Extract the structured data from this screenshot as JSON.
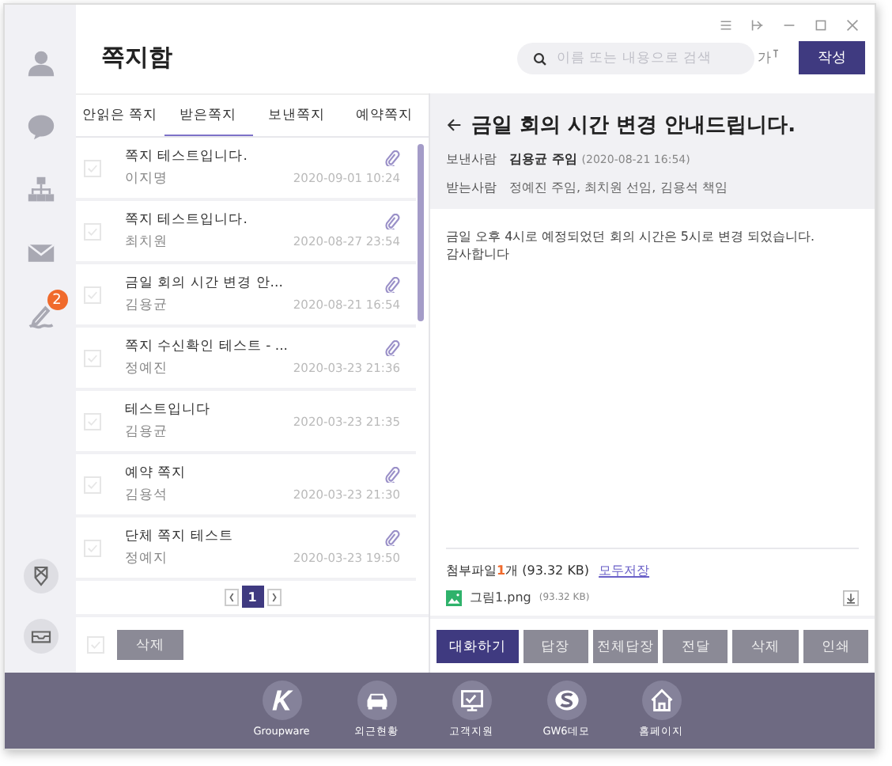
{
  "rail": {
    "badge": "2"
  },
  "header": {
    "title": "쪽지함",
    "search_placeholder": "이름 또는 내용으로 검색",
    "font_size_label": "가",
    "compose": "작성"
  },
  "tabs": [
    {
      "label": "안읽은 쪽지",
      "selected": false
    },
    {
      "label": "받은쪽지",
      "selected": true
    },
    {
      "label": "보낸쪽지",
      "selected": false
    },
    {
      "label": "예약쪽지",
      "selected": false
    }
  ],
  "messages": [
    {
      "subject": "쪽지 테스트입니다.",
      "sender": "이지명",
      "time": "2020-09-01 10:24",
      "attachment": true,
      "checked": false
    },
    {
      "subject": "쪽지 테스트입니다.",
      "sender": "최치원",
      "time": "2020-08-27 23:54",
      "attachment": true,
      "checked": false
    },
    {
      "subject": "금일 회의 시간 변경 안...",
      "sender": "김용균",
      "time": "2020-08-21 16:54",
      "attachment": true,
      "checked": false
    },
    {
      "subject": "쪽지 수신확인 테스트 - ...",
      "sender": "정예진",
      "time": "2020-03-23 21:36",
      "attachment": true,
      "checked": false
    },
    {
      "subject": "테스트입니다",
      "sender": "김용균",
      "time": "2020-03-23 21:35",
      "attachment": false,
      "checked": false
    },
    {
      "subject": "예약 쪽지",
      "sender": "김용석",
      "time": "2020-03-23 21:30",
      "attachment": true,
      "checked": false
    },
    {
      "subject": "단체 쪽지 테스트",
      "sender": "정예지",
      "time": "2020-03-23 19:50",
      "attachment": true,
      "checked": false
    }
  ],
  "pagination": {
    "page": "1"
  },
  "list_footer": {
    "select_all_checked": false,
    "delete": "삭제"
  },
  "detail": {
    "subject": "금일 회의 시간 변경 안내드립니다.",
    "from_label": "보낸사람",
    "from": "김용균 주임",
    "from_time": "(2020-08-21 16:54)",
    "to_label": "받는사람",
    "to": "정예진 주임, 최치원 선임, 김용석 책임",
    "body": [
      "금일 오후 4시로 예정되었던 회의 시간은 5시로 변경 되었습니다.",
      "감사합니다"
    ],
    "attach_label": "첨부파일",
    "attach_count": "1",
    "attach_suffix": "개 (93.32 KB)",
    "save_all": "모두저장",
    "files": [
      {
        "name": "그림1.png",
        "size": "(93.32 KB)"
      }
    ],
    "buttons": [
      {
        "label": "대화하기",
        "kind": "primary"
      },
      {
        "label": "답장",
        "kind": "secondary"
      },
      {
        "label": "전체답장",
        "kind": "secondary"
      },
      {
        "label": "전달",
        "kind": "secondary"
      },
      {
        "label": "삭제",
        "kind": "secondary"
      },
      {
        "label": "인쇄",
        "kind": "secondary"
      }
    ]
  },
  "dock": [
    {
      "label": "Groupware",
      "kind": "k"
    },
    {
      "label": "외근현황",
      "kind": "car"
    },
    {
      "label": "고객지원",
      "kind": "monitor"
    },
    {
      "label": "GW6데모",
      "kind": "s"
    },
    {
      "label": "홈페이지",
      "kind": "home"
    }
  ]
}
